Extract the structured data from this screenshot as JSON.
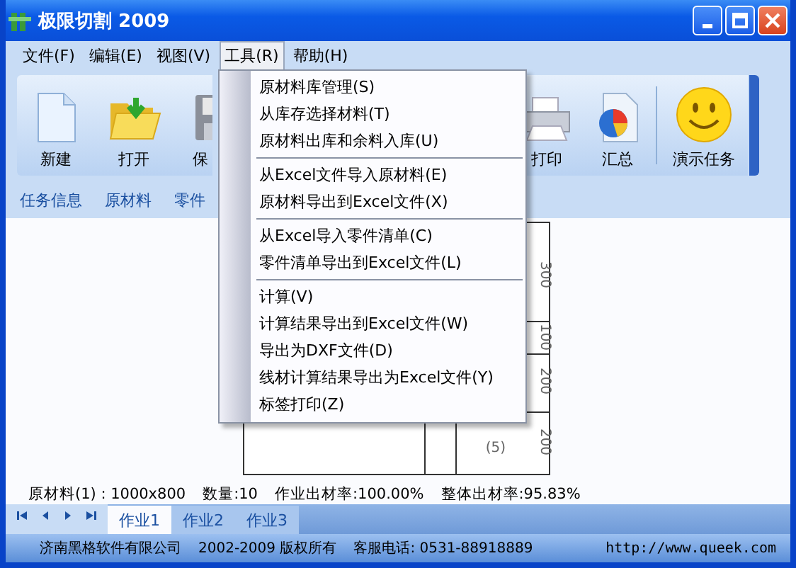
{
  "window": {
    "title": "极限切割  2009"
  },
  "menu_bar": [
    {
      "label": "文件(F)",
      "selected": false
    },
    {
      "label": "编辑(E)",
      "selected": false
    },
    {
      "label": "视图(V)",
      "selected": false
    },
    {
      "label": "工具(R)",
      "selected": true
    },
    {
      "label": "帮助(H)",
      "selected": false
    }
  ],
  "open_menu": {
    "groups": [
      [
        "原材料库管理(S)",
        "从库存选择材料(T)",
        "原材料出库和余料入库(U)"
      ],
      [
        "从Excel文件导入原材料(E)",
        "原材料导出到Excel文件(X)"
      ],
      [
        "从Excel导入零件清单(C)",
        "零件清单导出到Excel文件(L)"
      ],
      [
        "计算(V)",
        "计算结果导出到Excel文件(W)",
        "导出为DXF文件(D)",
        "线材计算结果导出为Excel文件(Y)",
        "标签打印(Z)"
      ]
    ]
  },
  "toolbar": [
    {
      "label": "新建",
      "kind": "new"
    },
    {
      "label": "打开",
      "kind": "open"
    },
    {
      "label": "保",
      "kind": "save"
    },
    {
      "label": "打印",
      "kind": "print"
    },
    {
      "label": "汇总",
      "kind": "summary"
    },
    {
      "label": "演示任务",
      "kind": "demo"
    }
  ],
  "sub_tabs": [
    "任务信息",
    "原材料",
    "零件"
  ],
  "drawing": {
    "labels": [
      {
        "text": "300",
        "kind": "dimension"
      },
      {
        "text": "100",
        "kind": "dimension"
      },
      {
        "text": "200",
        "kind": "dimension"
      },
      {
        "text": "200",
        "kind": "dimension"
      },
      {
        "text": "(5)",
        "kind": "part"
      }
    ]
  },
  "summary": [
    "原材料(1) :  1000x800",
    "数量:10",
    "作业出材率:100.00%",
    "整体出材率:95.83%"
  ],
  "sheet_tabs": [
    {
      "label": "作业1",
      "selected": true
    },
    {
      "label": "作业2",
      "selected": false
    },
    {
      "label": "作业3",
      "selected": false
    }
  ],
  "status_bar": [
    "济南黑格软件有限公司",
    "2002-2009 版权所有",
    "客服电话: 0531-88918889",
    "http://www.queek.com"
  ]
}
